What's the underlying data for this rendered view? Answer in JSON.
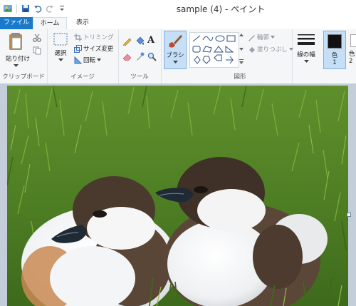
{
  "window": {
    "title": "sample (4) - ペイント"
  },
  "tabs": {
    "file": "ファイル",
    "home": "ホーム",
    "view": "表示"
  },
  "clipboard": {
    "paste": "貼り付け",
    "group": "クリップボード"
  },
  "image": {
    "select": "選択",
    "crop": "トリミング",
    "resize": "サイズ変更",
    "rotate": "回転",
    "group": "イメージ"
  },
  "tools": {
    "group": "ツール"
  },
  "brush": {
    "label": "ブラシ"
  },
  "shapes": {
    "outline": "輪郭",
    "fill": "塗りつぶし",
    "group": "図形"
  },
  "size": {
    "label": "線の幅"
  },
  "colors": {
    "color1": "色",
    "color1_num": "1",
    "color1_value": "#111111",
    "color2_partial": "色",
    "color2_num": "2"
  }
}
